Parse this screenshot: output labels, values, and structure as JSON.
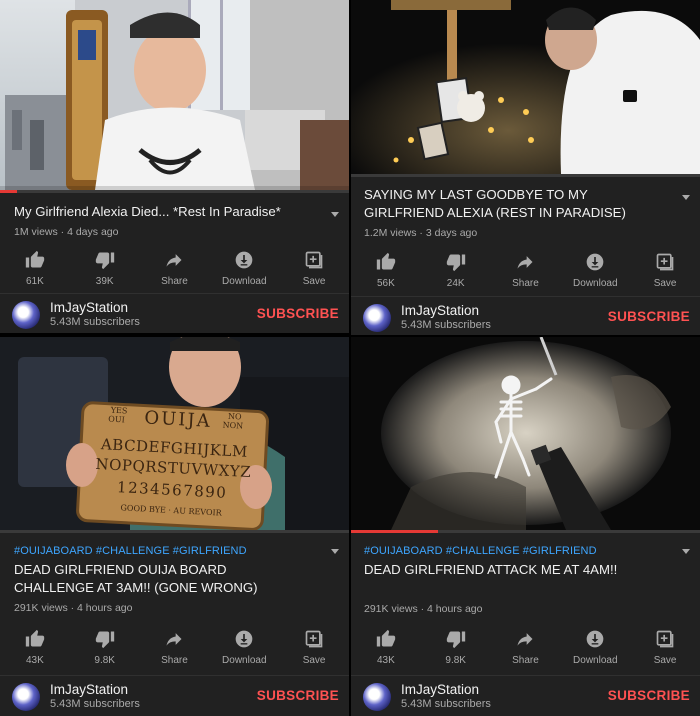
{
  "channel": {
    "name": "ImJayStation",
    "subscribers": "5.43M subscribers",
    "subscribe_label": "SUBSCRIBE"
  },
  "actions_labels": {
    "share": "Share",
    "download": "Download",
    "save": "Save"
  },
  "colors": {
    "accent_red": "#ff5252",
    "hashtag_blue": "#3ea6ff",
    "panel_bg": "#212121"
  },
  "videos": [
    {
      "hashtags": "",
      "title": "My Girlfriend Alexia Died... *Rest In Paradise*",
      "meta": "1M views · 4 days ago",
      "likes": "61K",
      "dislikes": "39K",
      "progress": 0.05
    },
    {
      "hashtags": "",
      "title": "SAYING MY LAST GOODBYE TO MY GIRLFRIEND ALEXIA (REST IN PARADISE)",
      "meta": "1.2M views · 3 days ago",
      "likes": "56K",
      "dislikes": "24K",
      "progress": 0.0
    },
    {
      "hashtags": "#OUIJABOARD #CHALLENGE #GIRLFRIEND",
      "title": "DEAD GIRLFRIEND OUIJA BOARD CHALLENGE AT 3AM!! (GONE WRONG)",
      "meta": "291K views · 4 hours ago",
      "likes": "43K",
      "dislikes": "9.8K",
      "progress": 0.0
    },
    {
      "hashtags": "#OUIJABOARD #CHALLENGE #GIRLFRIEND",
      "title": "DEAD GIRLFRIEND ATTACK ME AT 4AM!!",
      "meta": "291K views · 4 hours ago",
      "likes": "43K",
      "dislikes": "9.8K",
      "progress": 0.25
    }
  ],
  "ouija": {
    "yes": "YES",
    "oui": "OUI",
    "brand": "OUIJA",
    "no": "NO",
    "non": "NON",
    "row1": "ABCDEFGHIJKLM",
    "row2": "NOPQRSTUVWXYZ",
    "digits": "1234567890",
    "goodbye": "GOOD BYE · AU REVOIR"
  }
}
